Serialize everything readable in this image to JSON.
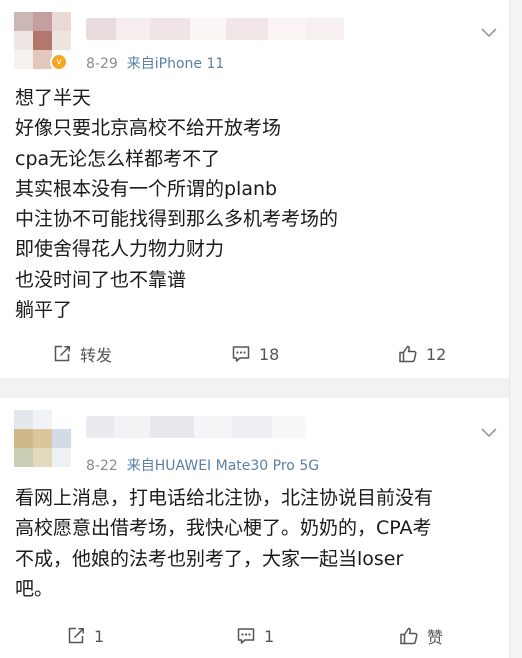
{
  "posts": [
    {
      "date": "8-29",
      "source": "来自iPhone 11",
      "verified_badge": "v",
      "content_lines": [
        "想了半天",
        "好像只要北京高校不给开放考场",
        "cpa无论怎么样都考不了",
        "其实根本没有一个所谓的planb",
        "中注协不可能找得到那么多机考考场的",
        "即使舍得花人力物力财力",
        "也没时间了也不靠谱",
        "躺平了"
      ],
      "actions": {
        "repost_label": "转发",
        "comment_count": "18",
        "like_count": "12"
      },
      "more_icon": "chevron-down-icon"
    },
    {
      "date": "8-22",
      "source": "来自HUAWEI Mate30 Pro 5G",
      "content_lines": [
        "看网上消息，打电话给北注协，北注协说目前没有",
        "高校愿意出借考场，我快心梗了。奶奶的，CPA考",
        "不成，他娘的法考也别考了，大家一起当loser",
        "吧。"
      ],
      "actions": {
        "repost_count": "1",
        "comment_count": "1",
        "like_label": "赞"
      },
      "more_icon": "chevron-down-icon"
    }
  ],
  "colors": {
    "text": "#1a1a1a",
    "meta": "#8c8c8c",
    "source_link": "#5b7fa6",
    "verified": "#f5a623",
    "feed_background": "#f2f2f2"
  }
}
